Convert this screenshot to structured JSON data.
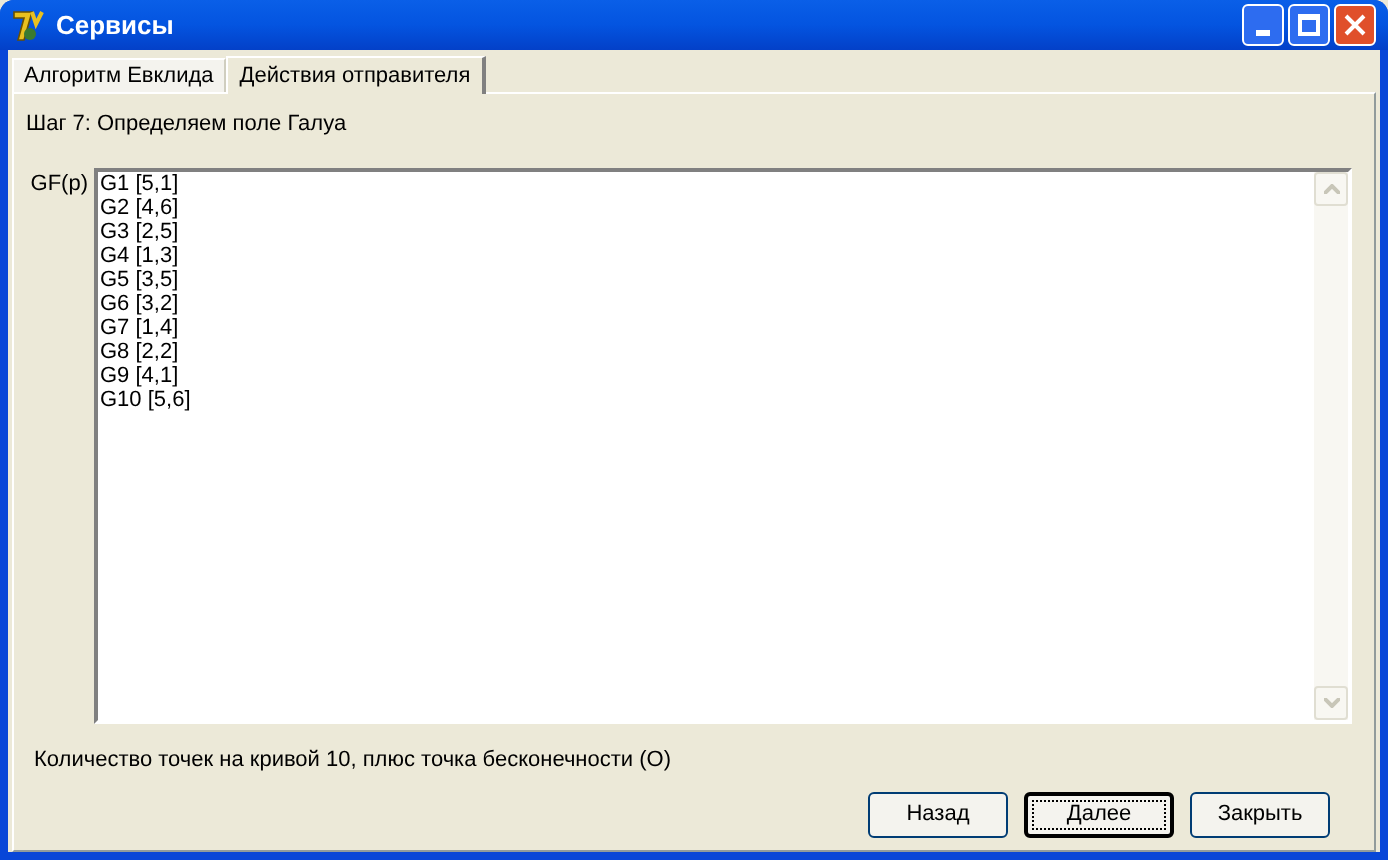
{
  "window": {
    "title": "Сервисы"
  },
  "tabs": [
    {
      "label": "Алгоритм Евклида",
      "selected": false
    },
    {
      "label": "Действия отправителя",
      "selected": true
    }
  ],
  "step": "Шаг 7: Определяем поле Галуа",
  "field_label": "GF(p)",
  "points": [
    "G1 [5,1]",
    "G2 [4,6]",
    "G3 [2,5]",
    "G4 [1,3]",
    "G5 [3,5]",
    "G6 [3,2]",
    "G7 [1,4]",
    "G8 [2,2]",
    "G9 [4,1]",
    "G10 [5,6]"
  ],
  "summary": "Количество точек на кривой 10, плюс точка бесконечности (O)",
  "buttons": [
    {
      "label": "Назад",
      "default": false
    },
    {
      "label": "Далее",
      "default": true
    },
    {
      "label": "Закрыть",
      "default": false
    }
  ]
}
